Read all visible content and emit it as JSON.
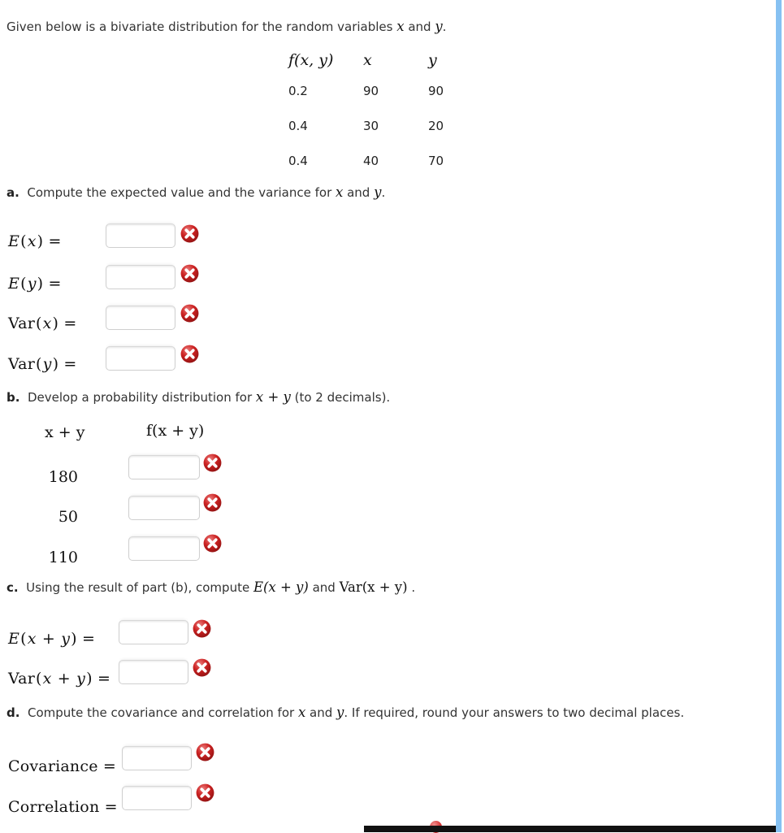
{
  "intro": {
    "text_before": "Given below is a bivariate distribution for the random variables ",
    "var_x": "x",
    "text_mid": " and ",
    "var_y": "y",
    "text_after": "."
  },
  "dist_table": {
    "headers": [
      "f(x, y)",
      "x",
      "y"
    ],
    "rows": [
      {
        "f": "0.2",
        "x": "90",
        "y": "90"
      },
      {
        "f": "0.4",
        "x": "30",
        "y": "20"
      },
      {
        "f": "0.4",
        "x": "40",
        "y": "70"
      }
    ]
  },
  "parts": {
    "a": {
      "marker": "a.",
      "prompt_before": "Compute the expected value and the variance for ",
      "prompt_x": "x",
      "prompt_mid": " and ",
      "prompt_y": "y",
      "prompt_after": ".",
      "rows": [
        {
          "label": "E(x) =",
          "value": "",
          "placeholder": "",
          "status": "incorrect"
        },
        {
          "label": "E(y) =",
          "value": "",
          "placeholder": "",
          "status": "incorrect"
        },
        {
          "label": "Var(x) =",
          "value": "",
          "placeholder": "",
          "status": "incorrect"
        },
        {
          "label": "Var(y) =",
          "value": "",
          "placeholder": "",
          "status": "incorrect"
        }
      ]
    },
    "b": {
      "marker": "b.",
      "prompt_before": "Develop a probability distribution for ",
      "prompt_expr": "x + y",
      "prompt_after": " (to 2 decimals).",
      "col_header_left": "x + y",
      "col_header_right": "f(x + y)",
      "rows": [
        {
          "xy": "180",
          "value": "",
          "placeholder": "",
          "status": "incorrect"
        },
        {
          "xy": "50",
          "value": "",
          "placeholder": "",
          "status": "incorrect"
        },
        {
          "xy": "110",
          "value": "",
          "placeholder": "",
          "status": "incorrect"
        }
      ]
    },
    "c": {
      "marker": "c.",
      "prompt_before": "Using the result of part (b), compute ",
      "prompt_expr1": "E(x + y)",
      "prompt_mid": " and ",
      "prompt_expr2": "Var(x + y)",
      "prompt_after": " .",
      "rows": [
        {
          "label": "E(x + y) =",
          "value": "",
          "placeholder": "",
          "status": "incorrect"
        },
        {
          "label": "Var(x + y) =",
          "value": "",
          "placeholder": "",
          "status": "incorrect"
        }
      ]
    },
    "d": {
      "marker": "d.",
      "prompt_before": "Compute the covariance and correlation for ",
      "prompt_x": "x",
      "prompt_mid": " and ",
      "prompt_y": "y",
      "prompt_after": ". If required, round your answers to two decimal places.",
      "rows": [
        {
          "label": "Covariance =",
          "value": "",
          "placeholder": "",
          "status": "incorrect"
        },
        {
          "label": "Correlation =",
          "value": "",
          "placeholder": "",
          "status": "incorrect"
        }
      ]
    }
  },
  "colors": {
    "error_red": "#c81e1e",
    "scrollbar_blue": "#86c1f2",
    "text": "#333333",
    "bar_black": "#111111"
  },
  "icons": {
    "error": "error-x-circle-icon"
  }
}
